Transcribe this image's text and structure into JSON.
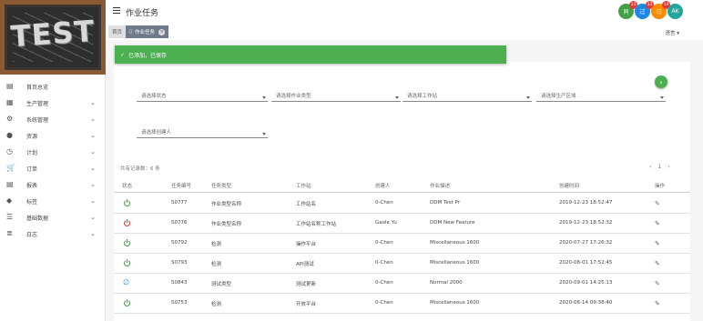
{
  "logo": {
    "text": "TEST"
  },
  "header": {
    "title": "作业任务"
  },
  "notifications": [
    {
      "label": "同",
      "count": "23",
      "color": "#43a047"
    },
    {
      "label": "过",
      "count": "33",
      "color": "#1e88e5"
    },
    {
      "label": "日",
      "count": "14",
      "color": "#fb8c00"
    },
    {
      "label": "AK",
      "count": "",
      "color": "#26a69a"
    }
  ],
  "tabs": {
    "home": "首页",
    "active": "作业任务"
  },
  "lang": "语言",
  "toast": {
    "message": "已添加，已保存"
  },
  "sidebar": {
    "items": [
      {
        "label": "首页总览",
        "icon": "dashboard-icon",
        "chevron": false
      },
      {
        "label": "生产管理",
        "icon": "grid-icon",
        "chevron": true
      },
      {
        "label": "系统管理",
        "icon": "gear-icon",
        "chevron": true
      },
      {
        "label": "资源",
        "icon": "circle-icon",
        "chevron": true
      },
      {
        "label": "计划",
        "icon": "clock-icon",
        "chevron": true
      },
      {
        "label": "订单",
        "icon": "cart-icon",
        "chevron": true
      },
      {
        "label": "报表",
        "icon": "doc-icon",
        "chevron": true
      },
      {
        "label": "标签",
        "icon": "tag-icon",
        "chevron": true
      },
      {
        "label": "基础数据",
        "icon": "server-icon",
        "chevron": true
      },
      {
        "label": "日志",
        "icon": "list-icon",
        "chevron": true
      }
    ]
  },
  "filters": [
    {
      "label": "请选择状态"
    },
    {
      "label": "请选择作业类型"
    },
    {
      "label": "请选择工作站"
    },
    {
      "label": "请选择生产区域"
    },
    {
      "label": "请选择创建人"
    }
  ],
  "table": {
    "total": "共有记录数：6 条",
    "pager": {
      "prev": "‹",
      "page": "1",
      "next": "›"
    },
    "columns": [
      "状态",
      "任务编号",
      "任务类型",
      "工作站",
      "创建人",
      "作业描述",
      "创建时间",
      "操作"
    ],
    "rows": [
      {
        "status": "green",
        "id": "S0777",
        "type": "作业类型名称",
        "station": "工作站名",
        "creator": "0-Chen",
        "desc": "DDM Test Pr",
        "time": "2019-12-23 18:52:47"
      },
      {
        "status": "red",
        "id": "S0776",
        "type": "作业类型名称",
        "station": "工作站名称工作站",
        "creator": "Gaole Yu",
        "desc": "DDM New Feature",
        "time": "2019-12-23 18:52:32"
      },
      {
        "status": "green",
        "id": "S0792",
        "type": "检测",
        "station": "操作平台",
        "creator": "0-Chen",
        "desc": "Miscellaneous 1600",
        "time": "2020-07-27 17:26:32"
      },
      {
        "status": "green",
        "id": "S0793",
        "type": "检测",
        "station": "API测试",
        "creator": "0-Chen",
        "desc": "Miscellaneous 1600",
        "time": "2020-08-01 17:52:45"
      },
      {
        "status": "link",
        "id": "S0843",
        "type": "测试类型",
        "station": "测试更新",
        "creator": "0-Chen",
        "desc": "Normal 2000",
        "time": "2020-09-01 14:25:13"
      },
      {
        "status": "green",
        "id": "S0753",
        "type": "检测",
        "station": "开放平台",
        "creator": "0-Chen",
        "desc": "Miscellaneous 1600",
        "time": "2020-06-14 09:38:40"
      }
    ]
  }
}
